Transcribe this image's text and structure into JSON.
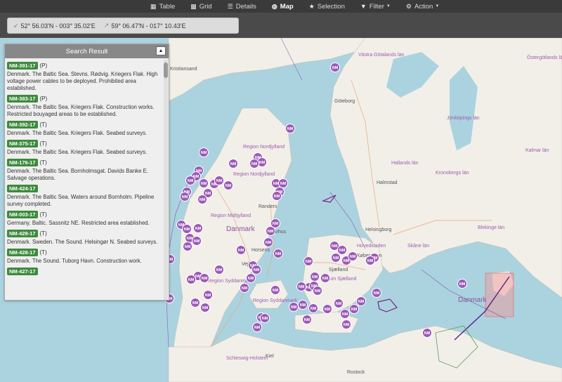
{
  "nav": {
    "table": "Table",
    "grid": "Grid",
    "details": "Details",
    "map": "Map",
    "selection": "Selection",
    "filter": "Filter",
    "action": "Action"
  },
  "coords": {
    "sw": "52° 56.03'N - 003° 35.02'E",
    "ne": "59° 06.47'N - 017° 10.43'E"
  },
  "panel": {
    "title": "Search Result",
    "results": [
      {
        "id": "NM-391-17",
        "type": "(P)",
        "text": "Denmark. The Baltic Sea. Stevns. Rødvig. Kriegers Flak. High voltage power cables to be deployed. Prohibited area established."
      },
      {
        "id": "NM-383-17",
        "type": "(P)",
        "text": "Denmark. The Baltic Sea. Kriegers Flak. Construction works. Restricted bouyaged areas to be established."
      },
      {
        "id": "NM-392-17",
        "type": "(T)",
        "text": "Denmark. The Baltic Sea. Kriegers Flak. Seabed surveys."
      },
      {
        "id": "NM-375-17",
        "type": "(T)",
        "text": "Denmark. The Baltic Sea. Kriegers Flak. Seabed surveys."
      },
      {
        "id": "NM-176-17",
        "type": "(T)",
        "text": "Denmark. The Baltic Sea. Bornholmsgat. Davids Banke E. Salvage operations."
      },
      {
        "id": "NM-424-17",
        "type": "",
        "text": "Denmark. The Baltic Sea. Waters around Bornholm. Pipeline survey completed."
      },
      {
        "id": "NM-003-17",
        "type": "(T)",
        "text": "Germany. Baltic. Sassnitz NE. Restricted area established."
      },
      {
        "id": "NM-429-17",
        "type": "(T)",
        "text": "Denmark. Sweden. The Sound. Helsingør N. Seabed surveys."
      },
      {
        "id": "NM-428-17",
        "type": "(T)",
        "text": "Denmark. The Sound. Tuborg Havn. Construction work."
      },
      {
        "id": "NM-427-17",
        "type": "",
        "text": ""
      }
    ]
  },
  "map": {
    "marker_label": "NM",
    "places": {
      "kristiansand": "Kristiansand",
      "goteborg": "Göteborg",
      "vastra_gotaland": "Västra Götalands län",
      "ostergotlands": "Östergötlands län",
      "jonkopings": "Jönköpings län",
      "kalmar": "Kalmar län",
      "kronobergs": "Kronobergs län",
      "hallands": "Hallands län",
      "halmstad": "Halmstad",
      "skane": "Skåne län",
      "blekinge": "Blekinge län",
      "helsingborg": "Helsingborg",
      "hovedstaden": "Hovedstaden",
      "kobenhavn": "København",
      "sjaelland": "Sjælland",
      "region_sjaelland": "Region Sjælland",
      "region_nordjylland": "Region Nordjylland",
      "nordjylland": "Nordjylland",
      "region_midtjylland": "Region Midtjylland",
      "danmark": "Danmark",
      "danmark2": "Danmark",
      "randers": "Randers",
      "aarhus": "Aarhus",
      "horsens": "Horsens",
      "vejle": "Vejle",
      "region_syddanmark": "Region Syddanmark",
      "region_syddanmark2": "Region Syddanmark",
      "kiel": "Kiel",
      "schleswig": "Schleswig-Holstein",
      "rostock": "Rostock"
    }
  },
  "colors": {
    "marker": "#9b59b6",
    "badge": "#3d8b3d",
    "sea": "#aad3df",
    "land": "#f2efe9"
  }
}
